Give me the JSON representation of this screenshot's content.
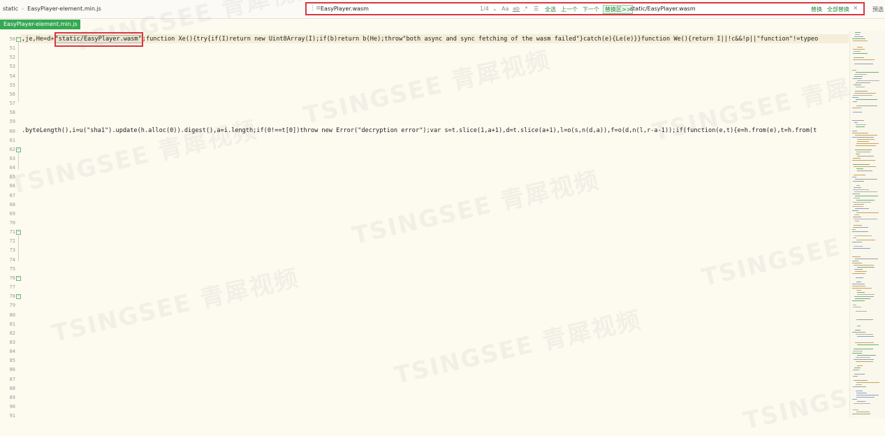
{
  "breadcrumb": {
    "folder": "static",
    "file": "EasyPlayer-element.min.js"
  },
  "find": {
    "query": "EasyPlayer.wasm",
    "count": "1/4",
    "match_case": "Aa",
    "whole_word": "ab",
    "regex": ".*",
    "select_all": "全选",
    "prev": "上一个",
    "next": "下一个",
    "replace_toggle": "替换区>>",
    "replace_value": "static/EasyPlayer.wasm",
    "replace": "替换",
    "replace_all": "全部替换",
    "close": "×"
  },
  "preview": "预选",
  "file_tab": "EasyPlayer-element.min.js",
  "code": {
    "line50_pre": ",je,He=d+",
    "line50_match": "\"static/EasyPlayer.wasm\"",
    "line50_post": ";function Xe(){try{if(I)return new Uint8Array(I);if(b)return b(He);throw\"both async and sync fetching of the wasm failed\"}catch(e){Le(e)}}function We(){return I||!c&&!p||\"function\"!=typeo",
    "line60": ".byteLength(),i=u(\"sha1\").update(h.alloc(0)).digest(),a=i.length;if(0!==t[0])throw new Error(\"decryption error\");var s=t.slice(1,a+1),d=t.slice(a+1),l=o(s,n(d,a)),f=o(d,n(l,r-a-1));if(function(e,t){e=h.from(e),t=h.from(t"
  },
  "line_numbers": [
    "50",
    "51",
    "52",
    "53",
    "54",
    "55",
    "56",
    "57",
    "58",
    "59",
    "60",
    "61",
    "62",
    "63",
    "64",
    "65",
    "66",
    "67",
    "68",
    "69",
    "70",
    "71",
    "72",
    "73",
    "74",
    "75",
    "76",
    "77",
    "78",
    "79",
    "80",
    "81",
    "82",
    "83",
    "84",
    "85",
    "86",
    "87",
    "88",
    "89",
    "90",
    "91"
  ],
  "watermark": "TSINGSEE 青犀视频"
}
